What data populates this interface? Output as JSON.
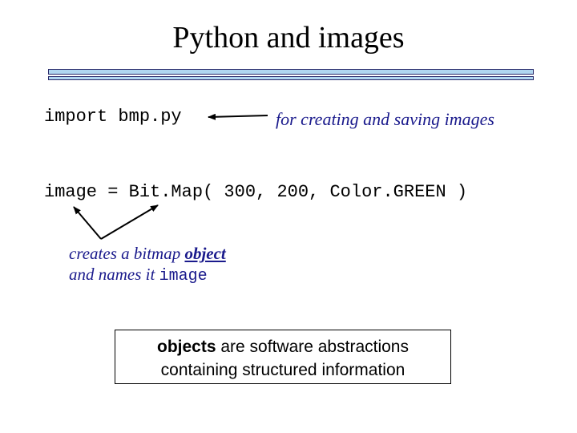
{
  "slide": {
    "title": "Python and images",
    "import_code": "import bmp.py",
    "import_note": "for creating and saving images",
    "image_code": "image = Bit.Map( 300, 200, Color.GREEN )",
    "bitmap_note": {
      "line1_prefix": "creates a bitmap ",
      "line1_emphasis": "object",
      "line2_prefix": "and names it ",
      "line2_code": "image"
    },
    "definition_box": {
      "term": "objects",
      "line1_rest": " are software abstractions",
      "line2": "containing structured information"
    }
  },
  "colors": {
    "title_bar_fill": "#b0d6f0",
    "title_bar_border": "#2a2a6a",
    "note_text": "#1a1a8c"
  }
}
